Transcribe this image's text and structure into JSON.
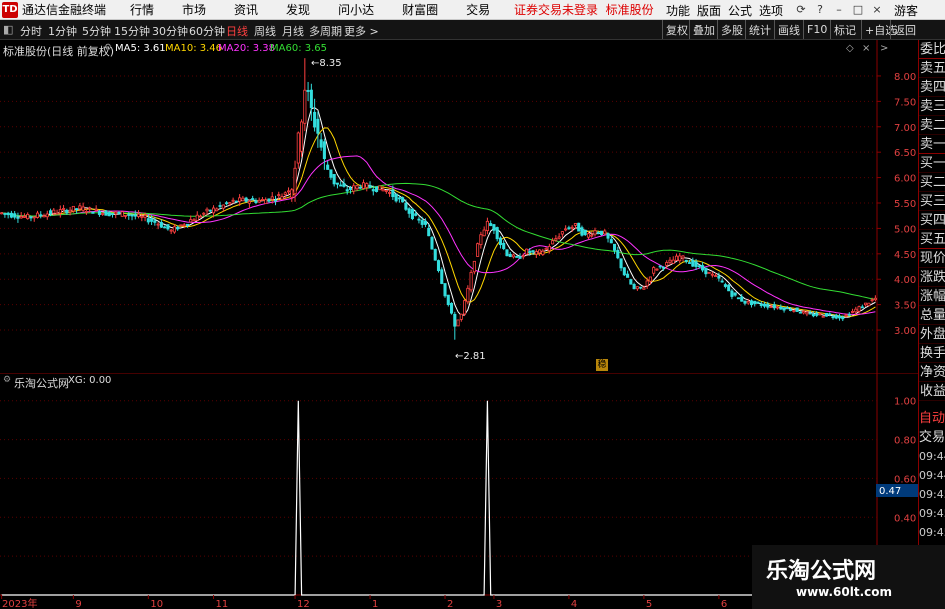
{
  "window": {
    "app_title": "通达信金融终端",
    "menus": [
      "行情",
      "市场",
      "资讯",
      "发现",
      "问小达",
      "财富圈",
      "交易"
    ],
    "status": "证券交易未登录",
    "stock_name": "标准股份",
    "right_menus": [
      "功能",
      "版面",
      "公式",
      "选项"
    ],
    "user": "游客"
  },
  "toolbar": {
    "periods": [
      "分时",
      "1分钟",
      "5分钟",
      "15分钟",
      "30分钟",
      "60分钟",
      "日线",
      "周线",
      "月线",
      "多周期",
      "更多 >"
    ],
    "active_period": "日线",
    "right_buttons": [
      "复权",
      "叠加",
      "多股",
      "统计",
      "画线",
      "F10",
      "标记",
      "+自选",
      "返回"
    ]
  },
  "main_chart": {
    "header": "标准股份(日线 前复权)",
    "ma": [
      {
        "label": "MA5: 3.61",
        "color": "#ffffff"
      },
      {
        "label": "MA10: 3.46",
        "color": "#ffd700"
      },
      {
        "label": "MA20: 3.38",
        "color": "#ff33ff"
      },
      {
        "label": "MA60: 3.65",
        "color": "#33dd33"
      }
    ],
    "high_label": "8.35",
    "low_label": "2.81",
    "signal_mark": "稳"
  },
  "indicator": {
    "header": "乐淘公式网",
    "value_label": "XG: 0.00",
    "current_value": "0.47"
  },
  "side_panel": {
    "items": [
      "委比",
      "卖五",
      "卖四",
      "卖三",
      "卖二",
      "卖一",
      "买一",
      "买二",
      "买三",
      "买四",
      "买五",
      "现价",
      "涨跌",
      "涨幅",
      "总量",
      "外盘",
      "换手",
      "净资",
      "收益"
    ],
    "bottom_items": [
      "自动",
      "交易"
    ],
    "times": [
      "09:44",
      "09:44",
      "09:45",
      "09:45",
      "09:45",
      "09:46",
      "09:46"
    ]
  },
  "watermark": {
    "title": "乐淘公式网",
    "url": "www.60lt.com"
  },
  "chart_data": {
    "type": "candlestick",
    "yticks_main": [
      3.0,
      3.5,
      4.0,
      4.5,
      5.0,
      5.5,
      6.0,
      6.5,
      7.0,
      7.5,
      8.0
    ],
    "ylim_main": [
      2.45,
      8.55
    ],
    "xtick_labels": [
      "2023年",
      "9",
      "10",
      "11",
      "12",
      "1",
      "2",
      "3",
      "4",
      "5",
      "6"
    ],
    "xtick_index": [
      0,
      22,
      45,
      65,
      90,
      113,
      136,
      151,
      174,
      197,
      220
    ],
    "anchors": [
      [
        0,
        5.3
      ],
      [
        8,
        5.22
      ],
      [
        16,
        5.32
      ],
      [
        24,
        5.4
      ],
      [
        32,
        5.3
      ],
      [
        38,
        5.28
      ],
      [
        44,
        5.2
      ],
      [
        48,
        5.1
      ],
      [
        52,
        4.95
      ],
      [
        56,
        5.1
      ],
      [
        62,
        5.3
      ],
      [
        66,
        5.4
      ],
      [
        72,
        5.55
      ],
      [
        80,
        5.55
      ],
      [
        86,
        5.65
      ],
      [
        89,
        5.85
      ],
      [
        91,
        6.7
      ],
      [
        93,
        7.8
      ],
      [
        95,
        7.3
      ],
      [
        97,
        6.9
      ],
      [
        99,
        6.3
      ],
      [
        102,
        5.9
      ],
      [
        106,
        5.75
      ],
      [
        110,
        5.85
      ],
      [
        114,
        5.8
      ],
      [
        118,
        5.75
      ],
      [
        122,
        5.55
      ],
      [
        126,
        5.25
      ],
      [
        130,
        5.05
      ],
      [
        132,
        4.6
      ],
      [
        134,
        4.2
      ],
      [
        136,
        3.7
      ],
      [
        138,
        3.3
      ],
      [
        139,
        3.1
      ],
      [
        141,
        3.3
      ],
      [
        143,
        3.8
      ],
      [
        145,
        4.4
      ],
      [
        147,
        4.9
      ],
      [
        149,
        5.1
      ],
      [
        151,
        5.0
      ],
      [
        153,
        4.7
      ],
      [
        155,
        4.5
      ],
      [
        158,
        4.4
      ],
      [
        161,
        4.55
      ],
      [
        164,
        4.5
      ],
      [
        167,
        4.6
      ],
      [
        170,
        4.8
      ],
      [
        173,
        5.0
      ],
      [
        176,
        5.05
      ],
      [
        179,
        4.85
      ],
      [
        182,
        4.95
      ],
      [
        185,
        4.9
      ],
      [
        188,
        4.55
      ],
      [
        191,
        4.1
      ],
      [
        194,
        3.8
      ],
      [
        197,
        3.85
      ],
      [
        200,
        4.2
      ],
      [
        204,
        4.3
      ],
      [
        208,
        4.45
      ],
      [
        212,
        4.3
      ],
      [
        216,
        4.15
      ],
      [
        220,
        4.0
      ],
      [
        224,
        3.7
      ],
      [
        228,
        3.55
      ],
      [
        233,
        3.5
      ],
      [
        238,
        3.45
      ],
      [
        243,
        3.4
      ],
      [
        248,
        3.3
      ],
      [
        253,
        3.3
      ],
      [
        258,
        3.25
      ],
      [
        262,
        3.4
      ],
      [
        266,
        3.55
      ],
      [
        268,
        3.62
      ]
    ],
    "bar_count": 269,
    "xg_spikes": [
      91,
      149
    ],
    "yticks_indicator": [
      0.2,
      0.4,
      0.6,
      0.8,
      1.0
    ],
    "ylim_indicator": [
      0,
      1.05
    ]
  }
}
